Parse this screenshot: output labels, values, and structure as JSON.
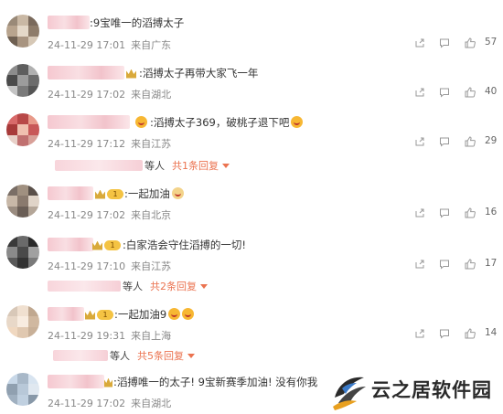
{
  "comments": [
    {
      "text": ":9宝唯一的滔搏太子",
      "time": "24-11-29 17:01",
      "location": "来自广东",
      "likes": "57"
    },
    {
      "text": ":滔搏太子再带大家飞一年",
      "time": "24-11-29 17:02",
      "location": "来自湖北",
      "likes": "40"
    },
    {
      "text": ":滔搏太子369，破桃子退下吧",
      "time": "24-11-29 17:12",
      "location": "来自江苏",
      "likes": "29",
      "replies": {
        "people": "等人",
        "link": "共1条回复"
      }
    },
    {
      "text": ":一起加油",
      "time": "24-11-29 17:02",
      "location": "来自北京",
      "likes": "16"
    },
    {
      "text": ":白家浩会守住滔搏的一切!",
      "time": "24-11-29 17:10",
      "location": "来自江苏",
      "likes": "17",
      "replies": {
        "people": "等人",
        "link": "共2条回复"
      }
    },
    {
      "text": ":一起加油9",
      "time": "24-11-29 19:31",
      "location": "来自上海",
      "likes": "14",
      "replies": {
        "people": "等人",
        "link": "共5条回复"
      }
    },
    {
      "text": ":滔搏唯一的太子! 9宝新赛季加油! 没有你我",
      "time": "24-11-29 17:02",
      "location": "来自湖北"
    }
  ],
  "badge_level": "1",
  "watermark": {
    "text": "云之居软件园"
  },
  "colors": {
    "accent": "#eb7350",
    "meta": "#888888",
    "icon": "#999999"
  },
  "icons": [
    "share-icon",
    "comment-icon",
    "like-icon"
  ]
}
